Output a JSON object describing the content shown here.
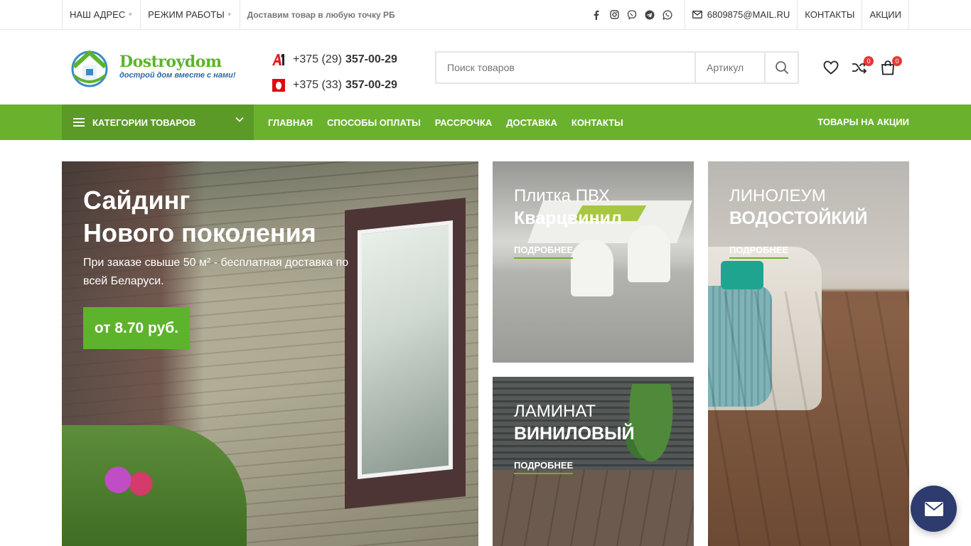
{
  "topbar": {
    "address": "НАШ АДРЕС",
    "hours": "РЕЖИМ РАБОТЫ",
    "delivery_note": "Доставим товар в любую точку РБ",
    "socials": [
      "facebook-icon",
      "instagram-icon",
      "viber-icon",
      "telegram-icon",
      "whatsapp-icon"
    ],
    "email": "6809875@MAIL.RU",
    "contacts": "КОНТАКТЫ",
    "promos": "АКЦИИ"
  },
  "header": {
    "logo_name": "Dostroydom",
    "logo_tagline": "дострой дом вместе с нами!",
    "phones": [
      {
        "operator": "A1",
        "prefix": "+375 (29)",
        "number": "357-00-29"
      },
      {
        "operator": "MTS",
        "prefix": "+375 (33)",
        "number": "357-00-29"
      }
    ],
    "search_placeholder": "Поиск товаров",
    "article_placeholder": "Артикул",
    "wishlist_count": "",
    "compare_count": "0",
    "cart_count": "0"
  },
  "nav": {
    "categories": "КАТЕГОРИИ ТОВАРОВ",
    "items": [
      "ГЛАВНАЯ",
      "СПОСОБЫ ОПЛАТЫ",
      "РАССРОЧКА",
      "ДОСТАВКА",
      "КОНТАКТЫ"
    ],
    "promo": "ТОВАРЫ НА АКЦИИ"
  },
  "banners": {
    "main": {
      "title_line1": "Сайдинг",
      "title_line2": "Нового поколения",
      "text": "При заказе свыше 50 м² - бесплатная доставка по всей Беларуси.",
      "price": "от 8.70 руб."
    },
    "tile": {
      "line1": "Плитка ПВХ",
      "line2": "Кварцвинил",
      "more": "ПОДРОБНЕЕ"
    },
    "laminate": {
      "line1": "ЛАМИНАТ",
      "line2": "ВИНИЛОВЫЙ",
      "more": "ПОДРОБНЕЕ"
    },
    "linoleum": {
      "line1": "ЛИНОЛЕУМ",
      "line2": "ВОДОСТОЙКИЙ",
      "more": "ПОДРОБНЕЕ"
    }
  },
  "colors": {
    "brand_green": "#6ab22e",
    "badge_red": "#e53935",
    "chat_navy": "#2e3b6f"
  }
}
